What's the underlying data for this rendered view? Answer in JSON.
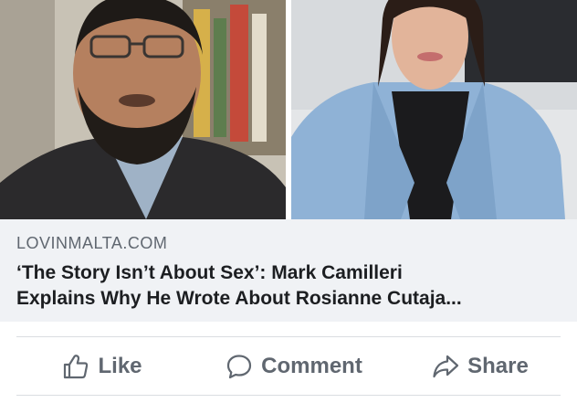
{
  "link_preview": {
    "images": [
      {
        "subject": "man with glasses and beard in front of bookshelf"
      },
      {
        "subject": "woman in blue blazer"
      }
    ],
    "domain": "LOVINMALTA.COM",
    "headline_line1": "‘The Story Isn’t About Sex’: Mark Camilleri",
    "headline_line2": "Explains Why He Wrote About Rosianne Cutaja..."
  },
  "actions": {
    "like_label": "Like",
    "like_icon": "thumbs-up-icon",
    "comment_label": "Comment",
    "comment_icon": "speech-bubble-icon",
    "share_label": "Share",
    "share_icon": "share-arrow-icon"
  },
  "colors": {
    "preview_background": "#f0f2f5",
    "secondary_text": "#606770",
    "primary_text": "#1c1e21",
    "divider": "#dadde1"
  }
}
